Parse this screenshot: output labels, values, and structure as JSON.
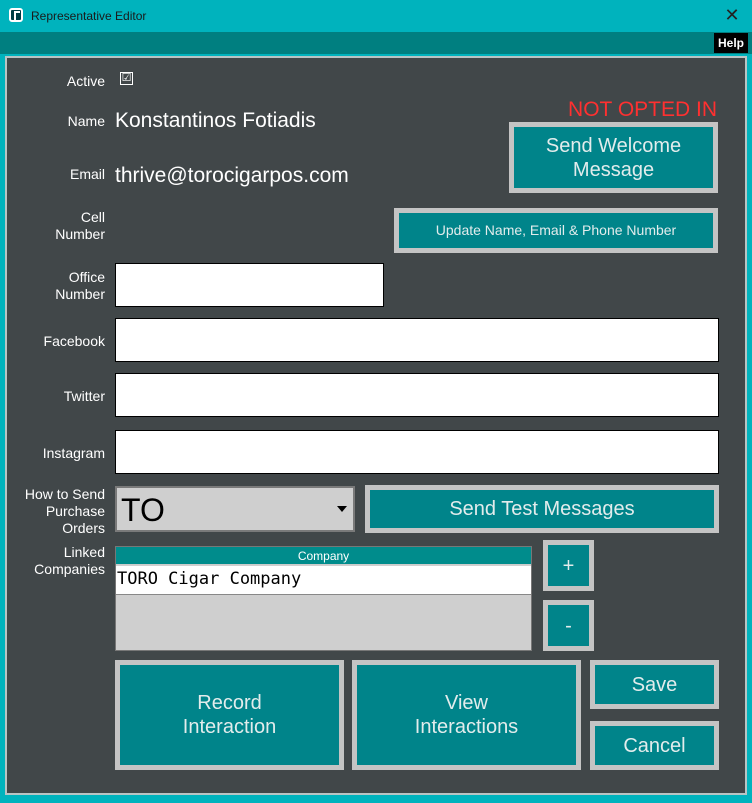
{
  "window": {
    "title": "Representative Editor",
    "close_glyph": "✕"
  },
  "menu": {
    "help_label": "Help"
  },
  "status": {
    "opt_in_text": "NOT OPTED IN",
    "color": "#ff3030"
  },
  "form": {
    "active": {
      "label": "Active",
      "checked": true,
      "glyph": "☑"
    },
    "name": {
      "label": "Name",
      "value": "Konstantinos Fotiadis"
    },
    "email": {
      "label": "Email",
      "value": "thrive@torocigarpos.com"
    },
    "cell": {
      "label_line1": "Cell",
      "label_line2": "Number"
    },
    "office": {
      "label_line1": "Office",
      "label_line2": "Number",
      "value": ""
    },
    "facebook": {
      "label": "Facebook",
      "value": ""
    },
    "twitter": {
      "label": "Twitter",
      "value": ""
    },
    "instagram": {
      "label": "Instagram",
      "value": ""
    },
    "purchase_orders": {
      "label_line1": "How to Send",
      "label_line2": "Purchase",
      "label_line3": "Orders",
      "selected": "TO"
    },
    "linked_companies": {
      "label_line1": "Linked",
      "label_line2": "Companies",
      "column_header": "Company",
      "rows": [
        "TORO Cigar Company"
      ]
    }
  },
  "buttons": {
    "send_welcome_line1": "Send Welcome",
    "send_welcome_line2": "Message",
    "update_contact": "Update Name, Email & Phone Number",
    "send_test": "Send Test Messages",
    "add": "+",
    "remove": "-",
    "record_line1": "Record",
    "record_line2": "Interaction",
    "view_line1": "View",
    "view_line2": "Interactions",
    "save": "Save",
    "cancel": "Cancel"
  },
  "colors": {
    "title_bar": "#00b3bd",
    "panel_bg": "#414749",
    "button_bg": "#00848a",
    "button_border": "#c4c4c4"
  }
}
